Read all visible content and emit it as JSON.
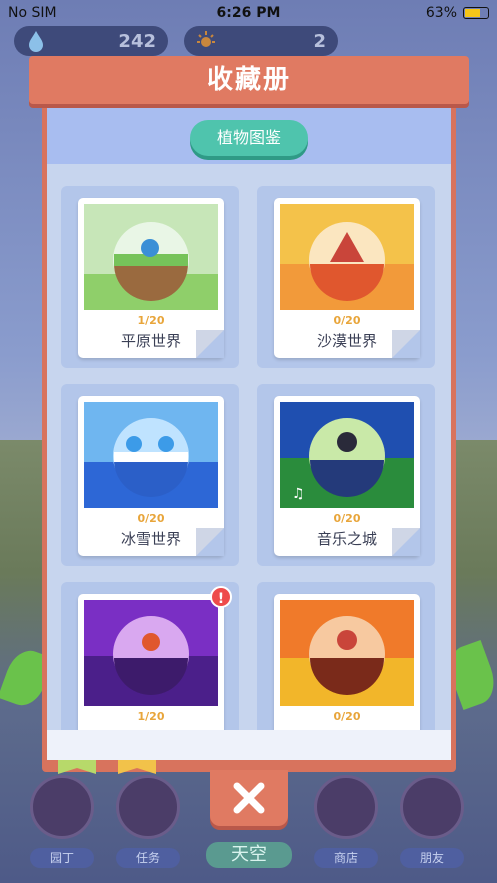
{
  "status_bar": {
    "carrier": "No SIM",
    "time": "6:26 PM",
    "battery": "63%"
  },
  "resources": {
    "water": "242",
    "sun": "2"
  },
  "modal": {
    "title": "收藏册",
    "tab": "植物图鉴",
    "worlds": [
      {
        "name": "平原世界",
        "progress": "1/20"
      },
      {
        "name": "沙漠世界",
        "progress": "0/20"
      },
      {
        "name": "冰雪世界",
        "progress": "0/20"
      },
      {
        "name": "音乐之城",
        "progress": "0/20"
      },
      {
        "name": "",
        "progress": "1/20",
        "alert": "!"
      },
      {
        "name": "",
        "progress": "0/20"
      }
    ]
  },
  "bottom_nav": [
    {
      "label": "园丁",
      "icon": "shovel-icon"
    },
    {
      "label": "任务",
      "icon": "task-icon"
    },
    {
      "label": "天空",
      "icon": "sky-icon"
    },
    {
      "label": "商店",
      "icon": "basket-icon"
    },
    {
      "label": "朋友",
      "icon": "friends-icon"
    }
  ],
  "colors": {
    "accent": "#e07a62",
    "tab": "#4fc4ad",
    "progress": "#e8a53a"
  }
}
